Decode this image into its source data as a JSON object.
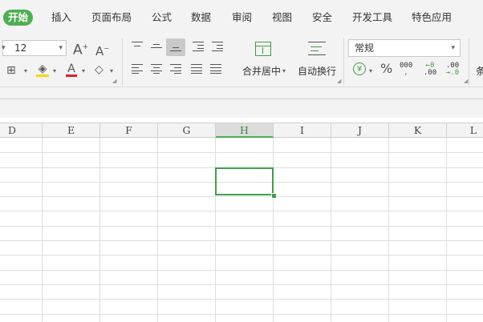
{
  "tabs": [
    "开始",
    "插入",
    "页面布局",
    "公式",
    "数据",
    "审阅",
    "视图",
    "安全",
    "开发工具",
    "特色应用"
  ],
  "ribbon": {
    "font_size": "12",
    "merge_center_label": "合并居中",
    "wrap_text_label": "自动换行",
    "number_format": "常规",
    "percent_symbol": "%",
    "comma_label": "000",
    "inc_decimal_top": "←0",
    "inc_decimal_bottom": ".00",
    "dec_decimal_top": ".00",
    "dec_decimal_bottom": "→.0",
    "grow_font": "A",
    "shrink_font": "A",
    "font_color_glyph": "A",
    "cut_label": "条"
  },
  "columns": [
    "D",
    "E",
    "F",
    "G",
    "H",
    "I",
    "J",
    "K",
    "L"
  ],
  "selected_column": "H",
  "colors": {
    "accent": "#4caf50",
    "selection": "#3f9f46",
    "font_color_bar": "#e02020",
    "fill_color_bar": "#f5d800"
  },
  "icons": {
    "border": "border-icon",
    "fill": "fill-color-icon",
    "font_color": "font-color-icon",
    "clear": "eraser-icon",
    "currency": "yen-icon"
  }
}
